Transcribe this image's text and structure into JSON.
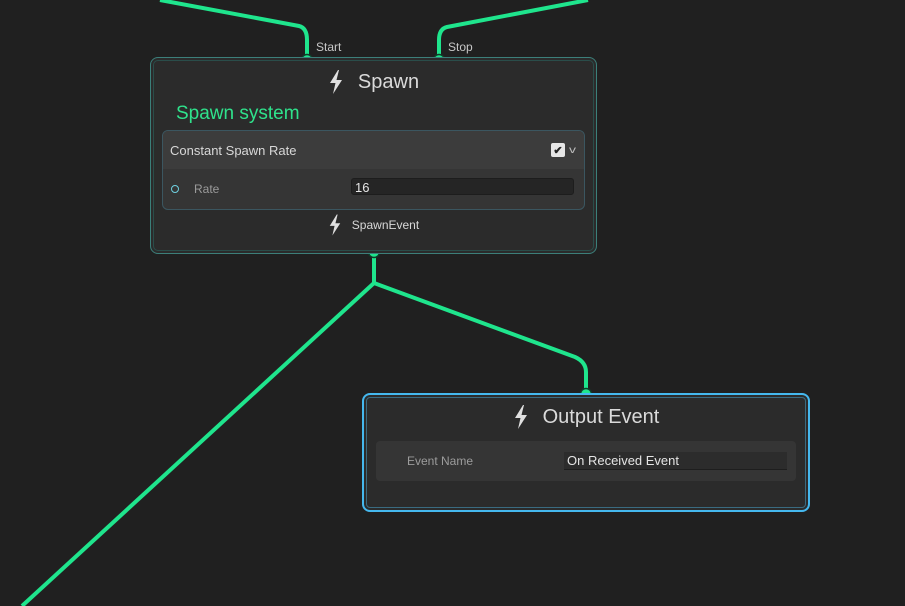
{
  "graph": {
    "wire_color": "#1fe58d",
    "spawn_node": {
      "title": "Spawn",
      "title_icon": "bolt-icon",
      "system_label": "Spawn system",
      "system_label_color": "#2fe28c",
      "ports_in": [
        {
          "label": "Start"
        },
        {
          "label": "Stop"
        }
      ],
      "block": {
        "title": "Constant Spawn Rate",
        "enabled": true,
        "check_glyph": "✔",
        "collapse_icon": "chevron-down-icon",
        "chevron_glyph": "v",
        "property": {
          "label": "Rate",
          "value": "16"
        }
      },
      "output": {
        "label": "SpawnEvent",
        "icon": "bolt-icon"
      }
    },
    "output_event_node": {
      "title": "Output Event",
      "title_icon": "bolt-icon",
      "selected": true,
      "selection_color": "#45b8ee",
      "field": {
        "label": "Event Name",
        "value": "On Received Event"
      }
    }
  }
}
